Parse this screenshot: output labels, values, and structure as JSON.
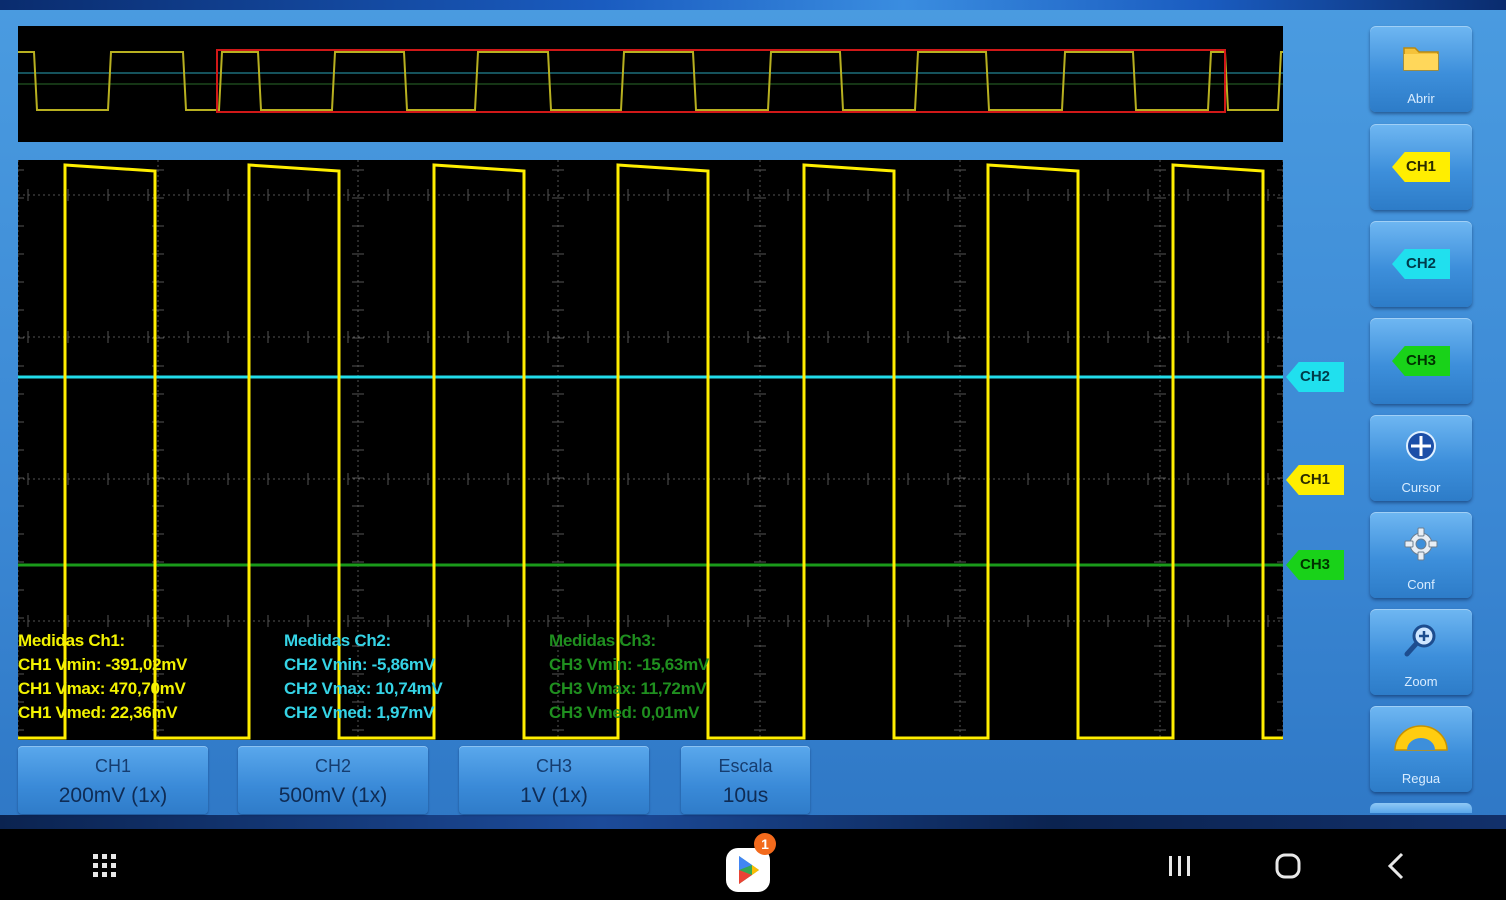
{
  "colors": {
    "ch1": "#ffee00",
    "ch2": "#22dcea",
    "ch3": "#1a9a1a",
    "overview_window": "#d01818",
    "grid": "#555555",
    "background": "#000000"
  },
  "markers": {
    "ch2": "CH2",
    "ch1": "CH1",
    "ch3": "CH3"
  },
  "measurements": {
    "ch1": {
      "title": "Medidas Ch1:",
      "vmin": "CH1 Vmin: -391,02mV",
      "vmax": "CH1 Vmax: 470,70mV",
      "vmed": "CH1 Vmed: 22,36mV"
    },
    "ch2": {
      "title": "Medidas Ch2:",
      "vmin": "CH2 Vmin: -5,86mV",
      "vmax": "CH2 Vmax: 10,74mV",
      "vmed": "CH2 Vmed: 1,97mV"
    },
    "ch3": {
      "title": "Medidas Ch3:",
      "vmin": "CH3 Vmin: -15,63mV",
      "vmax": "CH3 Vmax: 11,72mV",
      "vmed": "CH3 Vmed: 0,01mV"
    }
  },
  "sidebar": {
    "open": "Abrir",
    "ch1": "CH1",
    "ch2": "CH2",
    "ch3": "CH3",
    "cursor": "Cursor",
    "conf": "Conf",
    "zoom": "Zoom",
    "ruler": "Regua"
  },
  "bottom": {
    "ch1": {
      "label": "CH1",
      "value": "200mV (1x)"
    },
    "ch2": {
      "label": "CH2",
      "value": "500mV (1x)"
    },
    "ch3": {
      "label": "CH3",
      "value": "1V (1x)"
    },
    "scale": {
      "label": "Escala",
      "value": "10us"
    }
  },
  "navbar": {
    "play_badge": "1"
  },
  "icons": {
    "open": "folder-icon",
    "cursor": "crosshair-icon",
    "conf": "gear-icon",
    "zoom": "magnifier-icon",
    "ruler": "protractor-icon",
    "apps": "app-grid-icon",
    "recents": "recents-icon",
    "home": "home-icon",
    "back": "back-icon"
  }
}
